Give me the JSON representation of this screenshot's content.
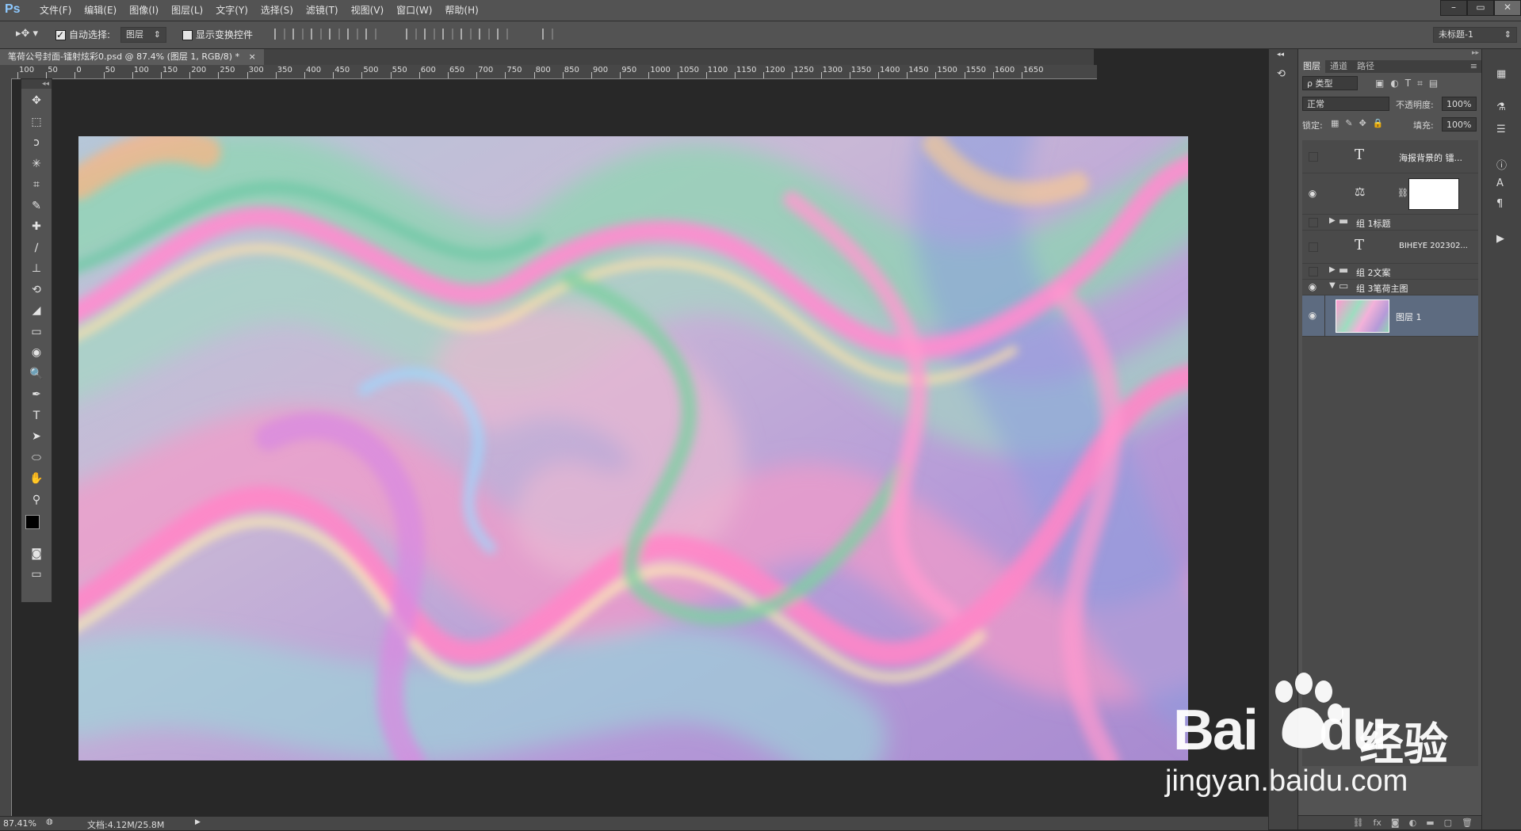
{
  "menubar": {
    "logo": "Ps",
    "items": [
      "文件(F)",
      "编辑(E)",
      "图像(I)",
      "图层(L)",
      "文字(Y)",
      "选择(S)",
      "滤镜(T)",
      "视图(V)",
      "窗口(W)",
      "帮助(H)"
    ],
    "window_controls": [
      "–",
      "▭",
      "✕"
    ]
  },
  "options": {
    "auto_select_label": "自动选择:",
    "auto_select_checked": true,
    "auto_select_target": "图层",
    "show_transform_label": "显示变换控件",
    "show_transform_checked": false,
    "workspace": "未标题-1"
  },
  "document": {
    "tab_title": "笔荷公号封面-镭射炫彩0.psd @ 87.4% (图层 1, RGB/8) *",
    "close_glyph": "×"
  },
  "ruler": {
    "h_ticks": [
      "100",
      "50",
      "0",
      "50",
      "100",
      "150",
      "200",
      "250",
      "300",
      "350",
      "400",
      "450",
      "500",
      "550",
      "600",
      "650",
      "700",
      "750",
      "800",
      "850",
      "900",
      "950",
      "1000",
      "1050",
      "1100",
      "1150",
      "1200",
      "1250",
      "1300",
      "1350",
      "1400",
      "1450",
      "1500",
      "1550",
      "1600",
      "1650"
    ]
  },
  "tools": [
    "move-tool",
    "marquee-tool",
    "lasso-tool",
    "magic-wand-tool",
    "crop-tool",
    "eyedropper-tool",
    "healing-tool",
    "brush-tool",
    "stamp-tool",
    "history-brush-tool",
    "eraser-tool",
    "gradient-tool",
    "blur-tool",
    "dodge-tool",
    "pen-tool",
    "type-tool",
    "path-select-tool",
    "shape-tool",
    "hand-tool",
    "zoom-tool"
  ],
  "tool_glyphs": [
    "✥",
    "⬚",
    "ↄ",
    "✳",
    "⌗",
    "✎",
    "✚",
    "∕",
    "⊥",
    "⟲",
    "◢",
    "▭",
    "◉",
    "🔍",
    "✒",
    "T",
    "➤",
    "⬭",
    "✋",
    "⚲"
  ],
  "colors": {
    "foreground": "#000000",
    "background": "#ffffff"
  },
  "layers_panel": {
    "tabs": [
      "图层",
      "通道",
      "路径"
    ],
    "filter_label": "ρ 类型",
    "blend_mode": "正常",
    "opacity_label": "不透明度:",
    "opacity_value": "100%",
    "lock_label": "锁定:",
    "fill_label": "填充:",
    "fill_value": "100%",
    "layers": [
      {
        "name": "海报背景的 镭...",
        "type": "text",
        "visible": false
      },
      {
        "name": "",
        "type": "adjustment",
        "visible": true
      },
      {
        "name": "组 1标题",
        "type": "group",
        "visible": false
      },
      {
        "name": "BIHEYE 202302...",
        "type": "text",
        "visible": false
      },
      {
        "name": "组 2文案",
        "type": "group",
        "visible": false
      },
      {
        "name": "组 3笔荷主图",
        "type": "group-open",
        "visible": true
      },
      {
        "name": "图层 1",
        "type": "pixel",
        "visible": true,
        "selected": true
      }
    ],
    "footer_icons": [
      "link-icon",
      "fx-icon",
      "mask-icon",
      "adjust-icon",
      "folder-icon",
      "new-layer-icon",
      "trash-icon"
    ]
  },
  "status": {
    "zoom": "87.41%",
    "doc_info": "文档:4.12M/25.8M"
  },
  "watermark": {
    "brand": "Bai",
    "brand_suffix": "du",
    "product": "经验",
    "url": "jingyan.baidu.com"
  }
}
